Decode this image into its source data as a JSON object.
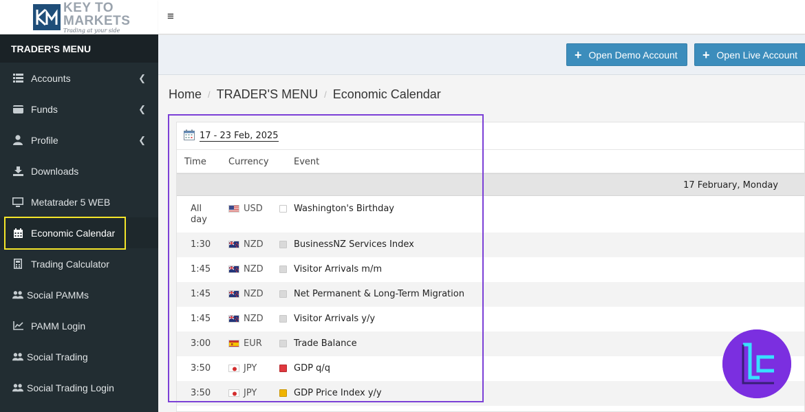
{
  "brand": {
    "line1": "KEY TO",
    "line2": "MARKETS",
    "tagline": "Trading at your side"
  },
  "sidebar": {
    "header": "TRADER'S MENU",
    "items": [
      {
        "label": "Accounts",
        "icon": "list-icon",
        "has_submenu": true
      },
      {
        "label": "Funds",
        "icon": "wallet-icon",
        "has_submenu": true
      },
      {
        "label": "Profile",
        "icon": "user-icon",
        "has_submenu": true
      },
      {
        "label": "Downloads",
        "icon": "download-icon",
        "has_submenu": false
      },
      {
        "label": "Metatrader 5 WEB",
        "icon": "monitor-icon",
        "has_submenu": false
      },
      {
        "label": "Economic Calendar",
        "icon": "calendar-icon",
        "has_submenu": false,
        "active": true
      },
      {
        "label": "Trading Calculator",
        "icon": "calculator-icon",
        "has_submenu": false
      },
      {
        "label": "Social PAMMs",
        "icon": "users-icon",
        "has_submenu": false
      },
      {
        "label": "PAMM Login",
        "icon": "chart-icon",
        "has_submenu": false
      },
      {
        "label": "Social Trading",
        "icon": "users-icon",
        "has_submenu": false
      },
      {
        "label": "Social Trading Login",
        "icon": "users-icon",
        "has_submenu": false
      }
    ]
  },
  "topbar": {
    "menu_toggle": "≡"
  },
  "actions": {
    "demo_label": "Open Demo Account",
    "live_label": "Open Live Account"
  },
  "breadcrumb": [
    "Home",
    "TRADER'S MENU",
    "Economic Calendar"
  ],
  "calendar": {
    "week_range": "17 - 23 Feb, 2025",
    "columns": {
      "time": "Time",
      "currency": "Currency",
      "event": "Event"
    },
    "day_label": "17 February, Monday",
    "events": [
      {
        "time": "All day",
        "currency": "USD",
        "flag": "us",
        "importance": "holiday",
        "event": "Washington's Birthday"
      },
      {
        "time": "1:30",
        "currency": "NZD",
        "flag": "nz",
        "importance": "low",
        "event": "BusinessNZ Services Index"
      },
      {
        "time": "1:45",
        "currency": "NZD",
        "flag": "nz",
        "importance": "low",
        "event": "Visitor Arrivals m/m"
      },
      {
        "time": "1:45",
        "currency": "NZD",
        "flag": "nz",
        "importance": "low",
        "event": "Net Permanent & Long-Term Migration"
      },
      {
        "time": "1:45",
        "currency": "NZD",
        "flag": "nz",
        "importance": "low",
        "event": "Visitor Arrivals y/y"
      },
      {
        "time": "3:00",
        "currency": "EUR",
        "flag": "es",
        "importance": "low",
        "event": "Trade Balance"
      },
      {
        "time": "3:50",
        "currency": "JPY",
        "flag": "jp",
        "importance": "high",
        "event": "GDP q/q"
      },
      {
        "time": "3:50",
        "currency": "JPY",
        "flag": "jp",
        "importance": "medium",
        "event": "GDP Price Index y/y"
      }
    ],
    "importance_colors": {
      "holiday": "#ffffff",
      "low": "#d9d9d9",
      "medium": "#f0b400",
      "high": "#e0383e"
    }
  },
  "colors": {
    "sidebar_bg": "#222d32",
    "primary_button": "#3c8dbc",
    "highlight_box": "#7b3fd6",
    "active_outline": "#f5e629"
  }
}
